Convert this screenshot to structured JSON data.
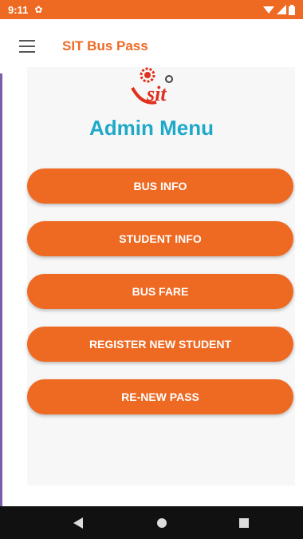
{
  "status_bar": {
    "time": "9:11",
    "icons": [
      "gear-icon",
      "wifi-icon",
      "signal-icon",
      "battery-icon"
    ]
  },
  "app_bar": {
    "title": "SIT Bus Pass",
    "menu_icon": "menu-icon"
  },
  "logo": {
    "text": "sit"
  },
  "main": {
    "heading": "Admin Menu",
    "buttons": [
      {
        "label": "BUS INFO"
      },
      {
        "label": "STUDENT INFO"
      },
      {
        "label": "BUS FARE"
      },
      {
        "label": "REGISTER NEW STUDENT"
      },
      {
        "label": "RE-NEW PASS"
      }
    ]
  },
  "nav_bar": {
    "icons": [
      "back-icon",
      "home-icon",
      "recents-icon"
    ]
  },
  "colors": {
    "accent": "#EE6A23",
    "heading": "#1FA9C9",
    "nav_bar": "#111111"
  }
}
